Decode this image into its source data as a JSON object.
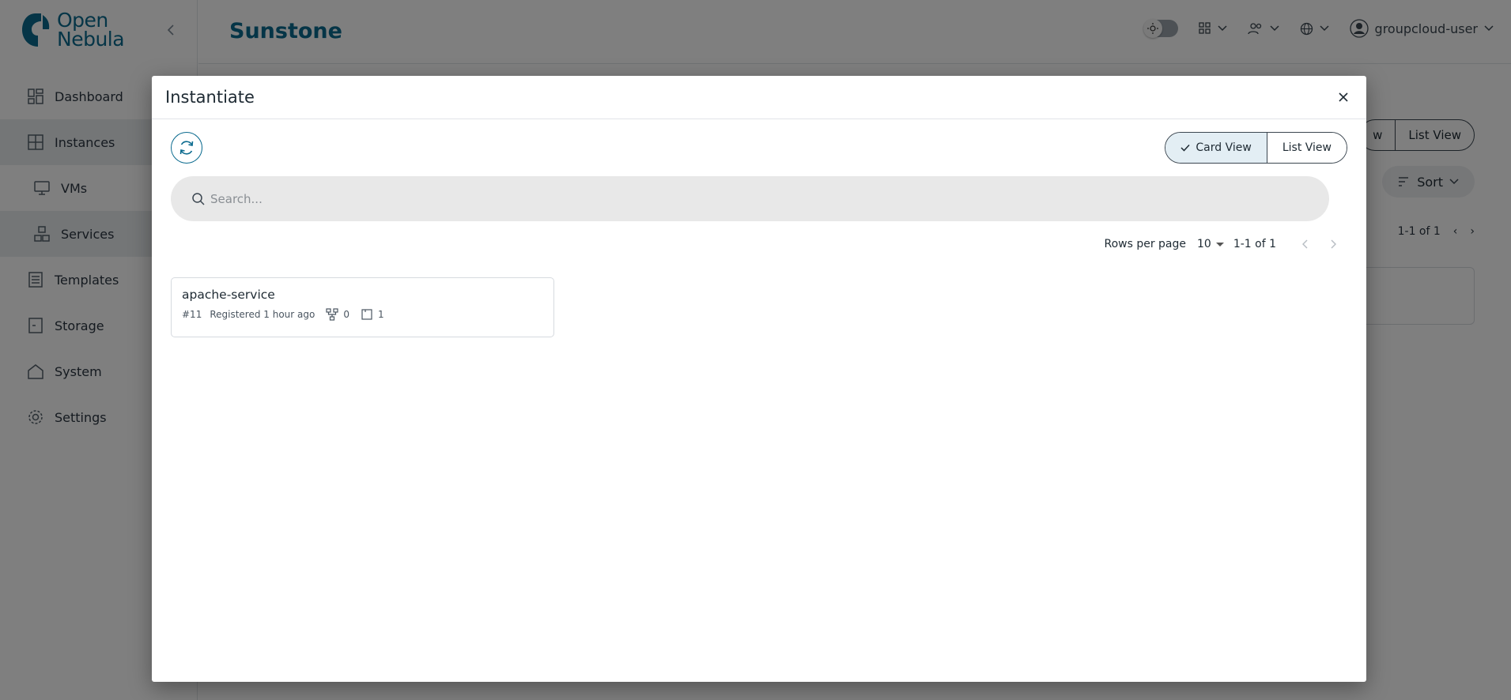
{
  "app": {
    "logo_line1": "Open",
    "logo_line2": "Nebula",
    "title": "Sunstone",
    "user": "groupcloud-user",
    "brand_color": "#0a6a8e"
  },
  "sidebar": {
    "items": [
      {
        "label": "Dashboard",
        "icon": "dashboard-icon"
      },
      {
        "label": "Instances",
        "icon": "instances-icon"
      },
      {
        "label": "VMs",
        "icon": "vm-icon"
      },
      {
        "label": "Services",
        "icon": "services-icon"
      },
      {
        "label": "Templates",
        "icon": "templates-icon"
      },
      {
        "label": "Storage",
        "icon": "storage-icon"
      },
      {
        "label": "System",
        "icon": "system-icon"
      },
      {
        "label": "Settings",
        "icon": "settings-icon"
      }
    ]
  },
  "background": {
    "view_toggle": [
      "w",
      "List View"
    ],
    "sort_label": "Sort",
    "pager_range": "1-1 of 1"
  },
  "modal": {
    "title": "Instantiate",
    "view_options": {
      "card": "Card View",
      "list": "List View",
      "selected": "Card View"
    },
    "search_placeholder": "Search...",
    "pagination": {
      "rows_label": "Rows per page",
      "rows_value": "10",
      "range": "1-1 of 1"
    },
    "cards": [
      {
        "name": "apache-service",
        "id": "#11",
        "registered": "Registered 1 hour ago",
        "networks": "0",
        "roles": "1"
      }
    ]
  }
}
